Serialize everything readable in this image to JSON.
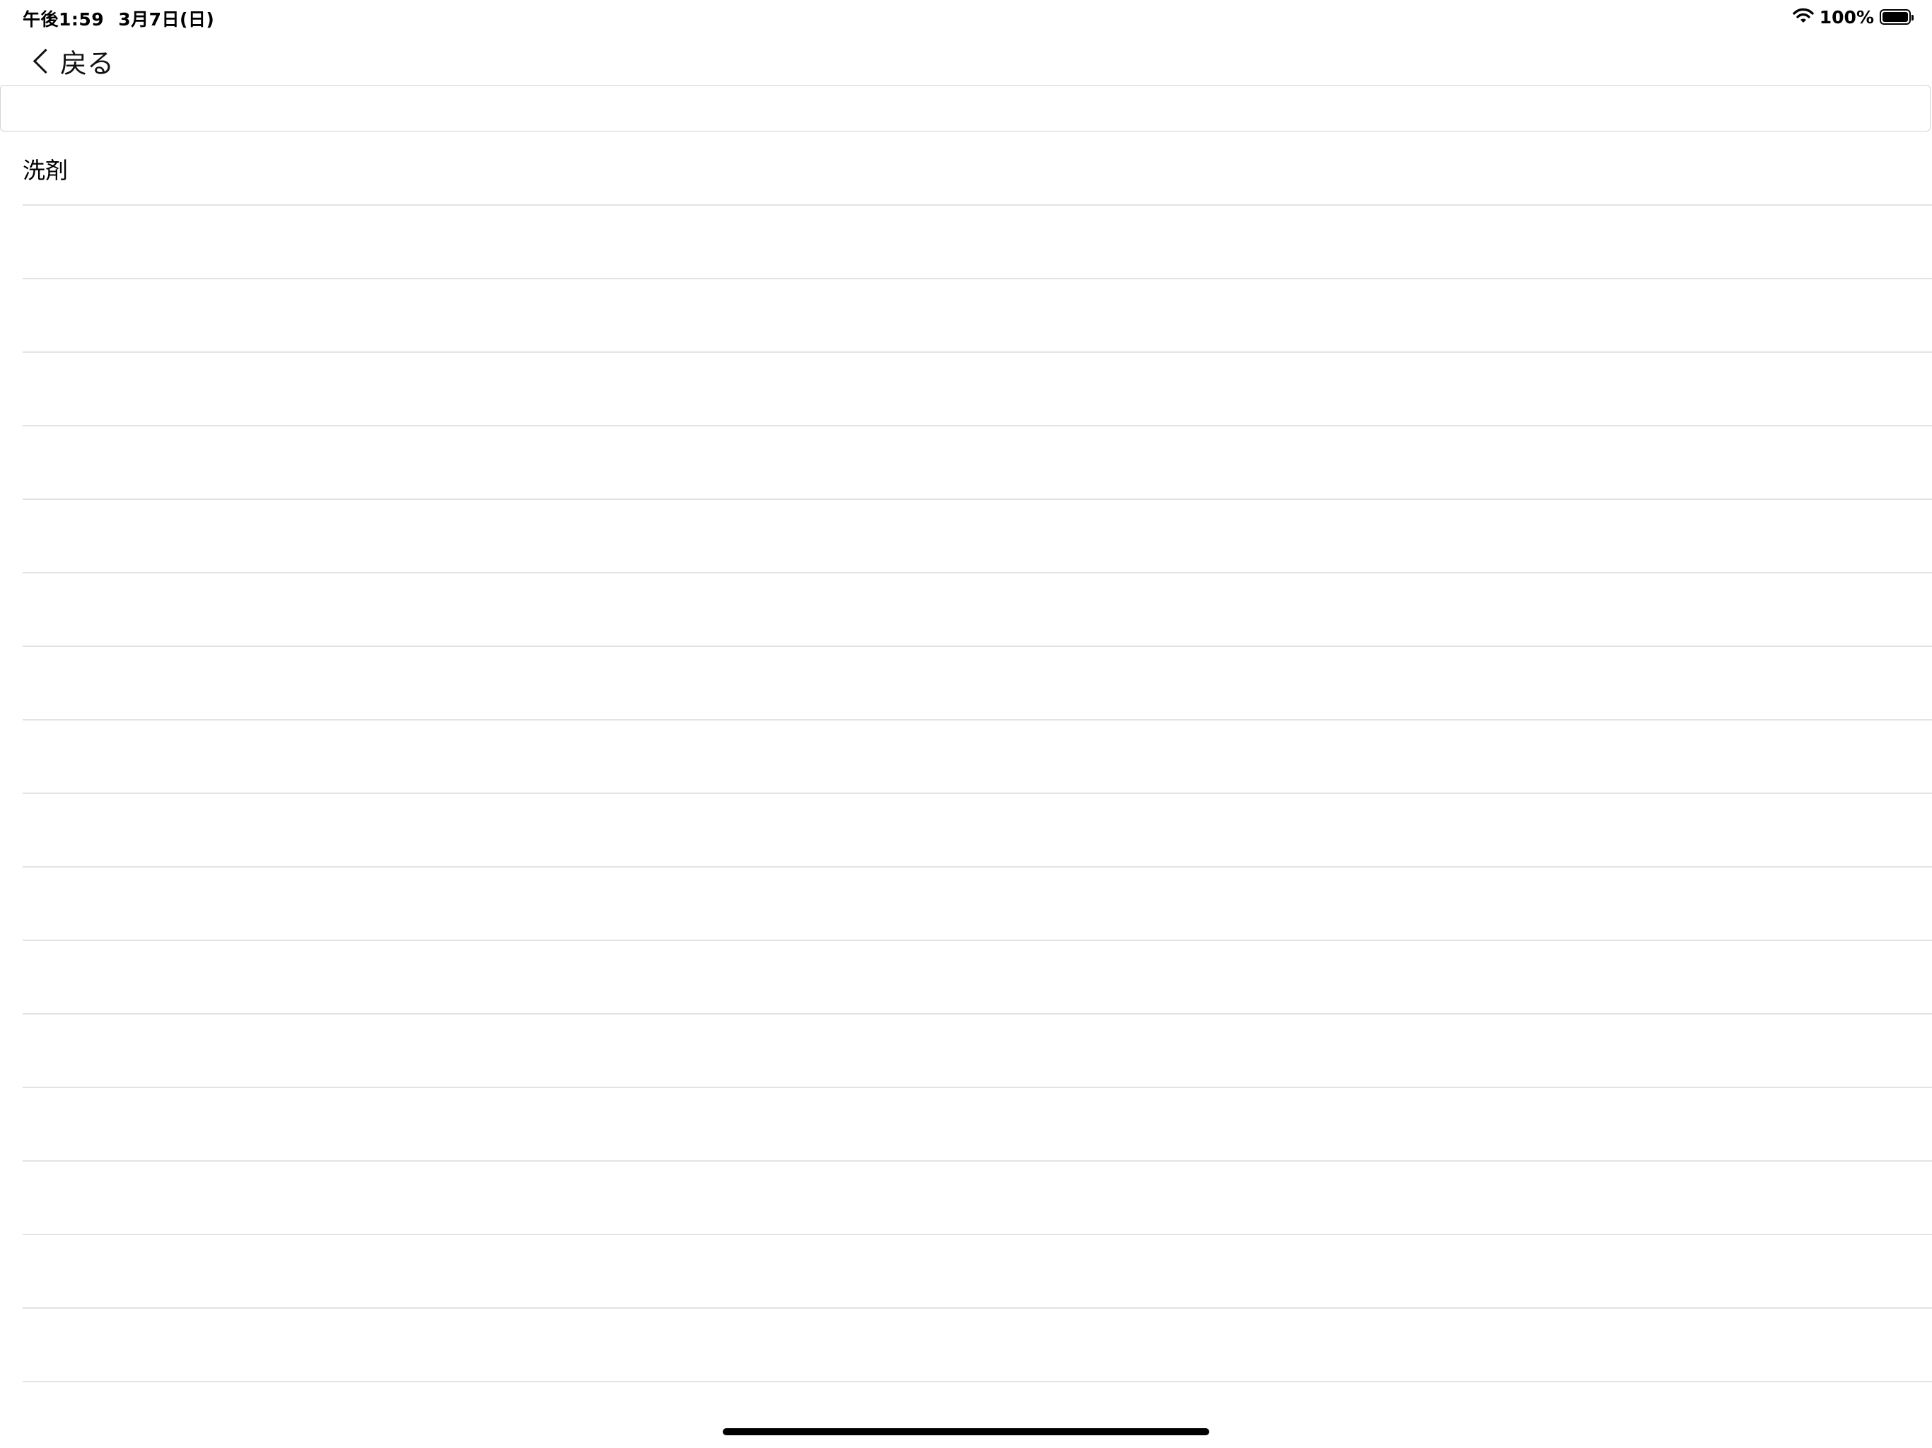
{
  "status_bar": {
    "time": "午後1:59",
    "date": "3月7日(日)",
    "battery_percent": "100%",
    "icons": [
      "wifi-icon",
      "battery-icon"
    ],
    "battery_level": 1.0
  },
  "nav": {
    "back_label": "戻る",
    "back_icon": "chevron-left-icon"
  },
  "search": {
    "value": "",
    "placeholder": ""
  },
  "list": {
    "items": [
      {
        "label": "洗剤"
      },
      {
        "label": ""
      },
      {
        "label": ""
      },
      {
        "label": ""
      },
      {
        "label": ""
      },
      {
        "label": ""
      },
      {
        "label": ""
      },
      {
        "label": ""
      },
      {
        "label": ""
      },
      {
        "label": ""
      },
      {
        "label": ""
      },
      {
        "label": ""
      },
      {
        "label": ""
      },
      {
        "label": ""
      },
      {
        "label": ""
      },
      {
        "label": ""
      },
      {
        "label": ""
      }
    ]
  },
  "colors": {
    "background": "#ffffff",
    "separator": "#e3e3e5",
    "field_border": "#d4d4d4",
    "text": "#000000"
  }
}
